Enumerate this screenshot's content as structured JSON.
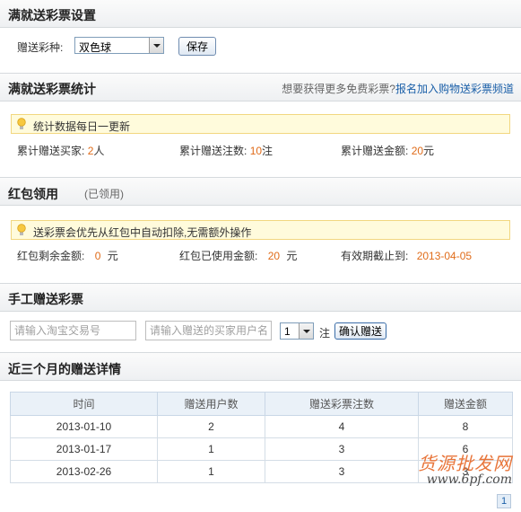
{
  "settings": {
    "title": "满就送彩票设置",
    "lottery_label": "赠送彩种:",
    "lottery_selected": "双色球",
    "save_label": "保存"
  },
  "stats": {
    "title": "满就送彩票统计",
    "promo_text": "想要获得更多免费彩票?",
    "promo_link": "报名加入购物送彩票频道",
    "tip": "统计数据每日一更新",
    "buyers_label": "累计赠送买家:",
    "buyers_value": "2",
    "buyers_unit": "人",
    "bets_label": "累计赠送注数:",
    "bets_value": "10",
    "bets_unit": "注",
    "amount_label": "累计赠送金额:",
    "amount_value": "20",
    "amount_unit": "元"
  },
  "redpacket": {
    "title": "红包领用",
    "status": "(已领用)",
    "tip": "送彩票会优先从红包中自动扣除,无需额外操作",
    "remaining_label": "红包剩余金额:",
    "remaining_value": "0",
    "remaining_unit": "元",
    "used_label": "红包已使用金额:",
    "used_value": "20",
    "used_unit": "元",
    "expiry_label": "有效期截止到:",
    "expiry_value": "2013-04-05"
  },
  "manual": {
    "title": "手工赠送彩票",
    "order_placeholder": "请输入淘宝交易号",
    "buyer_placeholder": "请输入赠送的买家用户名",
    "qty_selected": "1",
    "qty_unit": "注",
    "confirm_label": "确认赠送"
  },
  "details": {
    "title": "近三个月的赠送详情",
    "columns": [
      "时间",
      "赠送用户数",
      "赠送彩票注数",
      "赠送金额"
    ],
    "rows": [
      [
        "2013-01-10",
        "2",
        "4",
        "8"
      ],
      [
        "2013-01-17",
        "1",
        "3",
        "6"
      ],
      [
        "2013-02-26",
        "1",
        "3",
        "3"
      ]
    ]
  },
  "watermark": {
    "main": "货源批发网",
    "sub": "www.6pf.com"
  },
  "corner_badge": "1",
  "colors": {
    "accent_number": "#e06c1a",
    "link": "#1a5fa8",
    "tip_background": "#fffbdc"
  }
}
